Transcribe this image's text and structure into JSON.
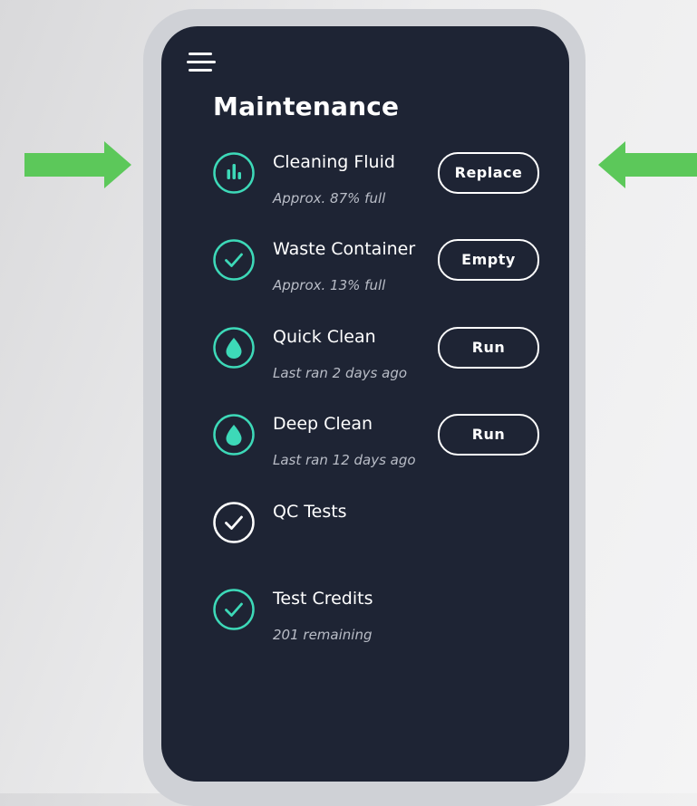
{
  "page": {
    "title": "Maintenance"
  },
  "colors": {
    "background": "#1e2434",
    "accent": "#3dd9b8",
    "frame": "#cfd1d6",
    "arrow": "#5cc85a"
  },
  "icons": {
    "menu": "hamburger-menu-icon",
    "arrows": "arrow-icon"
  },
  "items": [
    {
      "name": "Cleaning Fluid",
      "status": "Approx. 87% full",
      "level_percent": 87,
      "icon": "bar-level-icon",
      "button": "Replace"
    },
    {
      "name": "Waste Container",
      "status": "Approx. 13% full",
      "level_percent": 13,
      "icon": "check-circle-icon",
      "button": "Empty"
    },
    {
      "name": "Quick Clean",
      "status": "Last ran 2 days ago",
      "icon": "droplet-icon",
      "button": "Run"
    },
    {
      "name": "Deep Clean",
      "status": "Last ran 12 days ago",
      "icon": "droplet-icon",
      "button": "Run"
    },
    {
      "name": "QC Tests",
      "status": "",
      "icon": "check-circle-icon"
    },
    {
      "name": "Test Credits",
      "status": "201 remaining",
      "icon": "check-circle-icon"
    }
  ]
}
